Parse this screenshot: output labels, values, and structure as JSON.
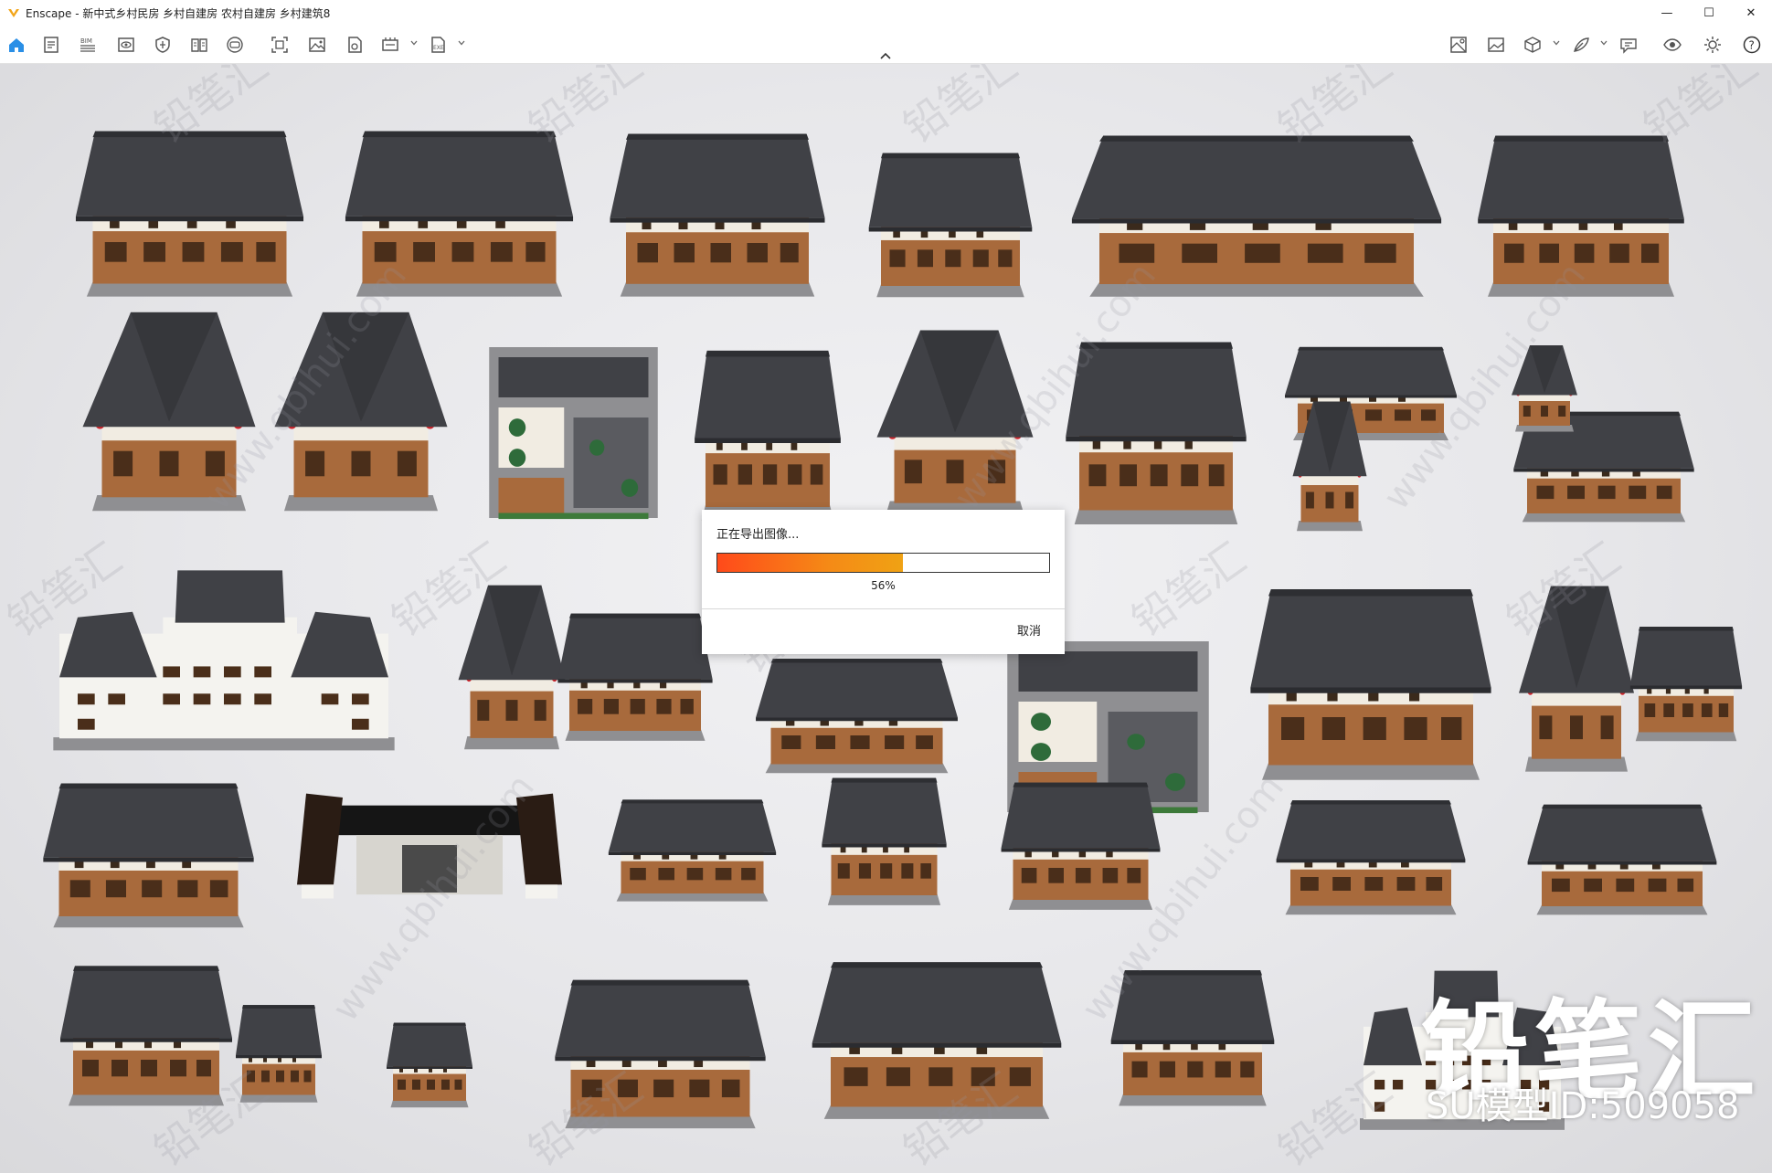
{
  "window": {
    "app_name": "Enscape",
    "title": "Enscape - 新中式乡村民房 乡村自建房 农村自建房 乡村建筑8",
    "controls": {
      "minimize": "—",
      "maximize": "☐",
      "close": "✕"
    }
  },
  "toolbar": {
    "left_tools": [
      {
        "icon": "home-icon"
      },
      {
        "icon": "document-icon"
      },
      {
        "icon": "bim-icon",
        "label": "BIM"
      },
      {
        "icon": "eye-screen-icon"
      },
      {
        "icon": "shield-icon"
      },
      {
        "icon": "book-icon"
      },
      {
        "icon": "vr-icon"
      },
      {
        "icon": "capture-icon"
      },
      {
        "icon": "image-icon"
      },
      {
        "icon": "save-icon"
      },
      {
        "icon": "render-export-icon"
      },
      {
        "icon": "exe-export-icon",
        "label": "EXE"
      }
    ],
    "right_tools": [
      {
        "icon": "material-icon"
      },
      {
        "icon": "image-view-icon"
      },
      {
        "icon": "cube-icon"
      },
      {
        "icon": "feather-icon"
      },
      {
        "icon": "chat-icon"
      },
      {
        "icon": "visibility-icon"
      },
      {
        "icon": "settings-icon"
      },
      {
        "icon": "help-icon",
        "label": "?"
      }
    ]
  },
  "export_dialog": {
    "title": "正在导出图像...",
    "progress_percent": 56,
    "progress_label": "56%",
    "cancel_label": "取消"
  },
  "watermark": {
    "brand": "铅笔汇",
    "model_id": "SU模型ID:509058",
    "tile": "铅笔汇",
    "url": "www.qbihui.com"
  },
  "colors": {
    "accent": "#f0a214",
    "progress_start": "#ff4a1a",
    "roof": "#404146",
    "wood": "#a86a3c",
    "stone": "#8f8f92"
  }
}
